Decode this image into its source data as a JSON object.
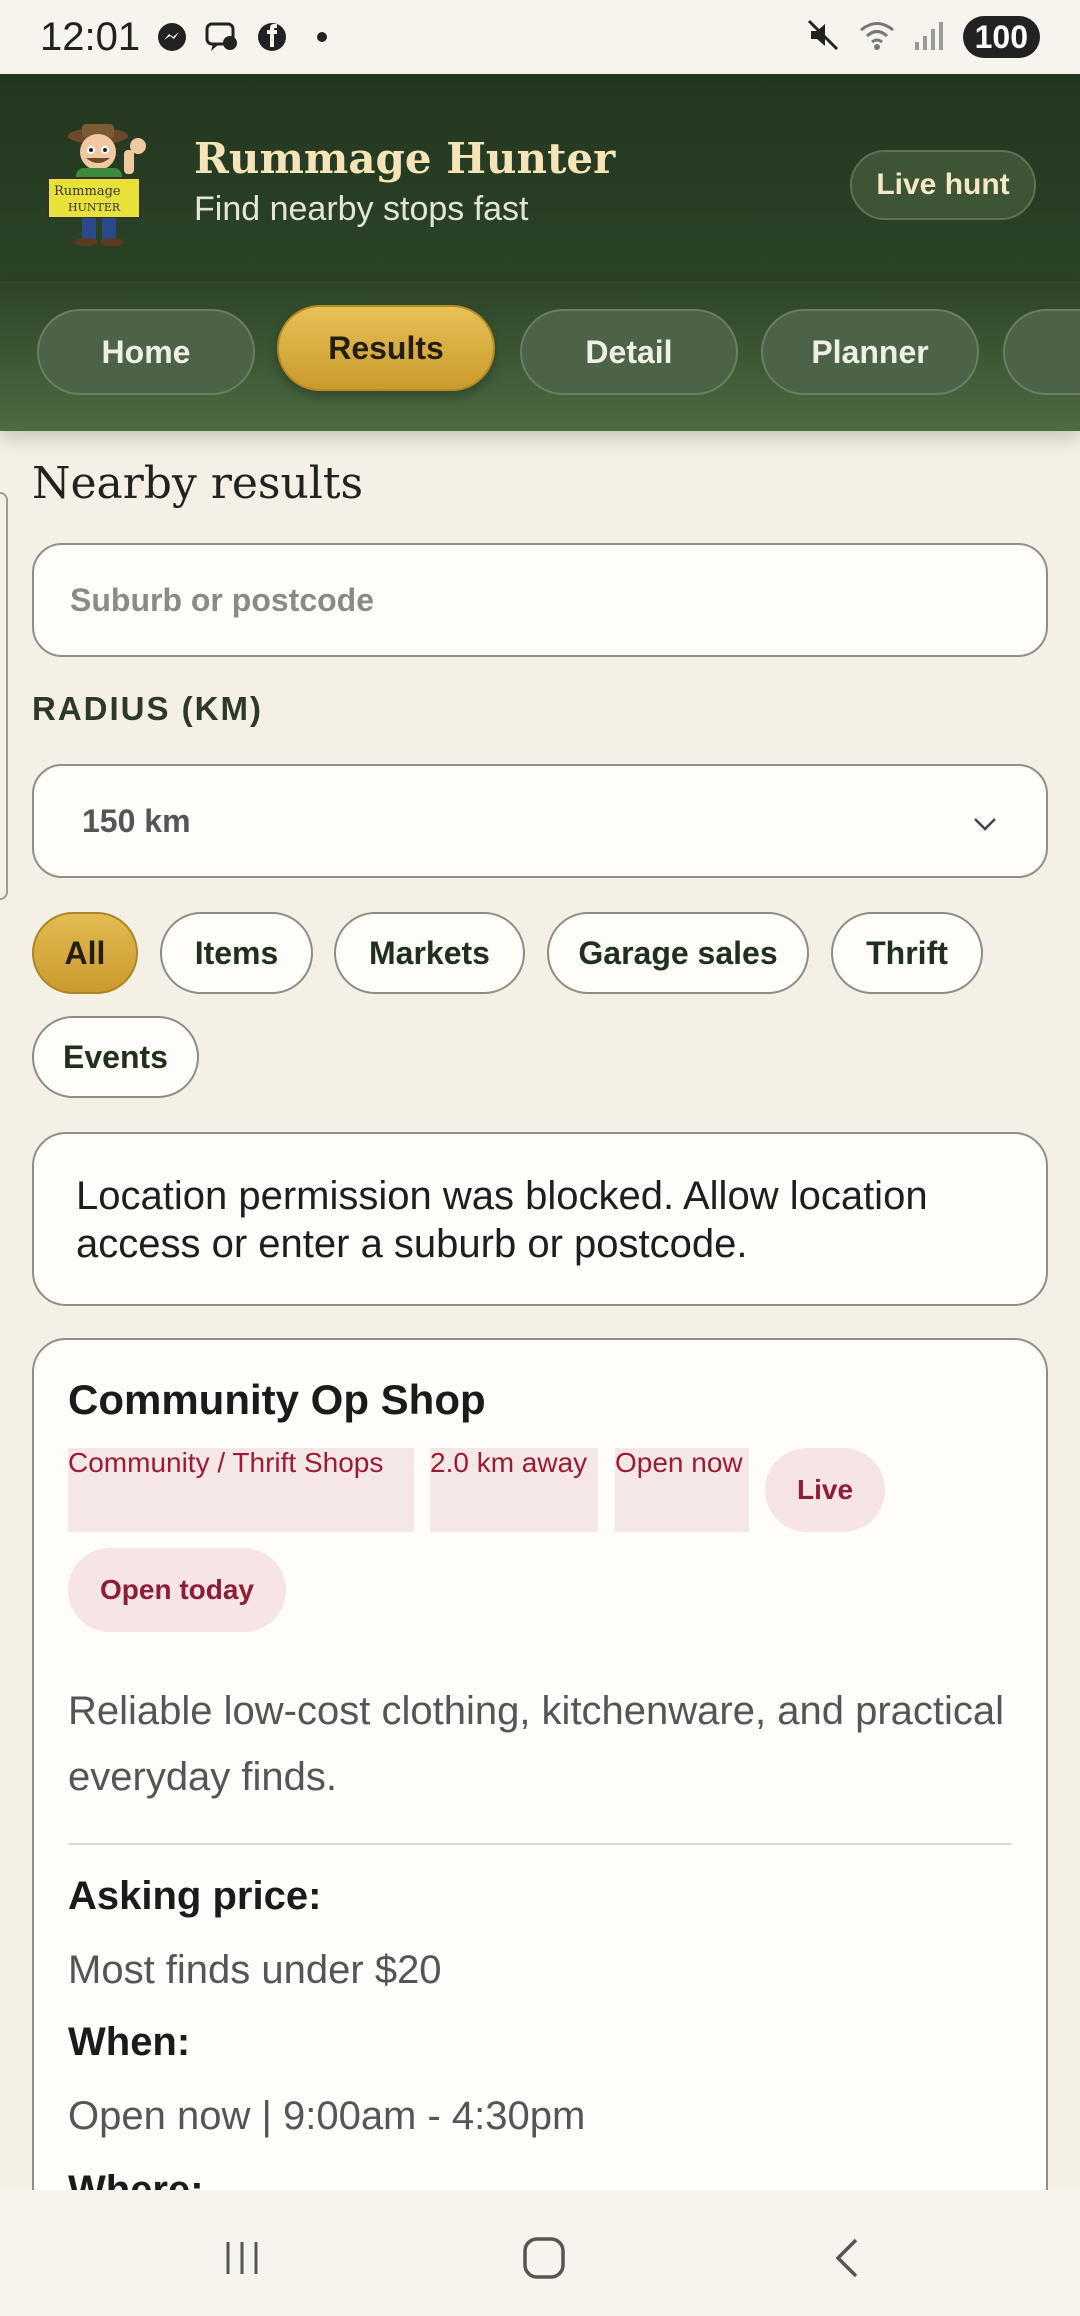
{
  "status": {
    "time": "12:01",
    "battery": "100"
  },
  "header": {
    "title": "Rummage Hunter",
    "subtitle": "Find nearby stops fast",
    "live_hunt_label": "Live hunt",
    "logo_sign_text": "Rummage HUNTER"
  },
  "tabs": [
    {
      "label": "Home",
      "active": false
    },
    {
      "label": "Results",
      "active": true
    },
    {
      "label": "Detail",
      "active": false
    },
    {
      "label": "Planner",
      "active": false
    },
    {
      "label": "",
      "active": false
    }
  ],
  "main": {
    "title": "Nearby results",
    "search": {
      "placeholder": "Suburb or postcode",
      "value": ""
    },
    "radius": {
      "label": "RADIUS (KM)",
      "selected": "150 km"
    },
    "filters": [
      {
        "label": "All",
        "active": true
      },
      {
        "label": "Items",
        "active": false
      },
      {
        "label": "Markets",
        "active": false
      },
      {
        "label": "Garage sales",
        "active": false
      },
      {
        "label": "Thrift",
        "active": false
      },
      {
        "label": "Events",
        "active": false
      }
    ],
    "notice": "Location permission was blocked. Allow location access or enter a suburb or postcode."
  },
  "result": {
    "title": "Community Op Shop",
    "category": "Community / Thrift Shops",
    "distance": "2.0 km away",
    "open_status": "Open now",
    "live_badge": "Live",
    "open_today_badge": "Open today",
    "description": "Reliable low-cost clothing, kitchenware, and practical everyday finds.",
    "asking_price_label": "Asking price:",
    "asking_price": "Most finds under $20",
    "when_label": "When:",
    "when": "Open now | 9:00am - 4:30pm",
    "where_label": "Where:"
  },
  "colors": {
    "header_bg": "#24361f",
    "accent_gold": "#d4a838",
    "badge_text": "#9b1b34",
    "badge_bg": "#f6e4e6",
    "page_bg": "#f4f0e6"
  },
  "icons": {
    "status_left": [
      "messenger-icon",
      "chat-bubble-icon",
      "facebook-icon",
      "dot-icon"
    ],
    "status_right": [
      "mute-icon",
      "wifi-icon",
      "signal-icon"
    ],
    "nav": [
      "recent-apps-icon",
      "home-icon",
      "back-icon"
    ],
    "select": "chevron-down-icon"
  }
}
